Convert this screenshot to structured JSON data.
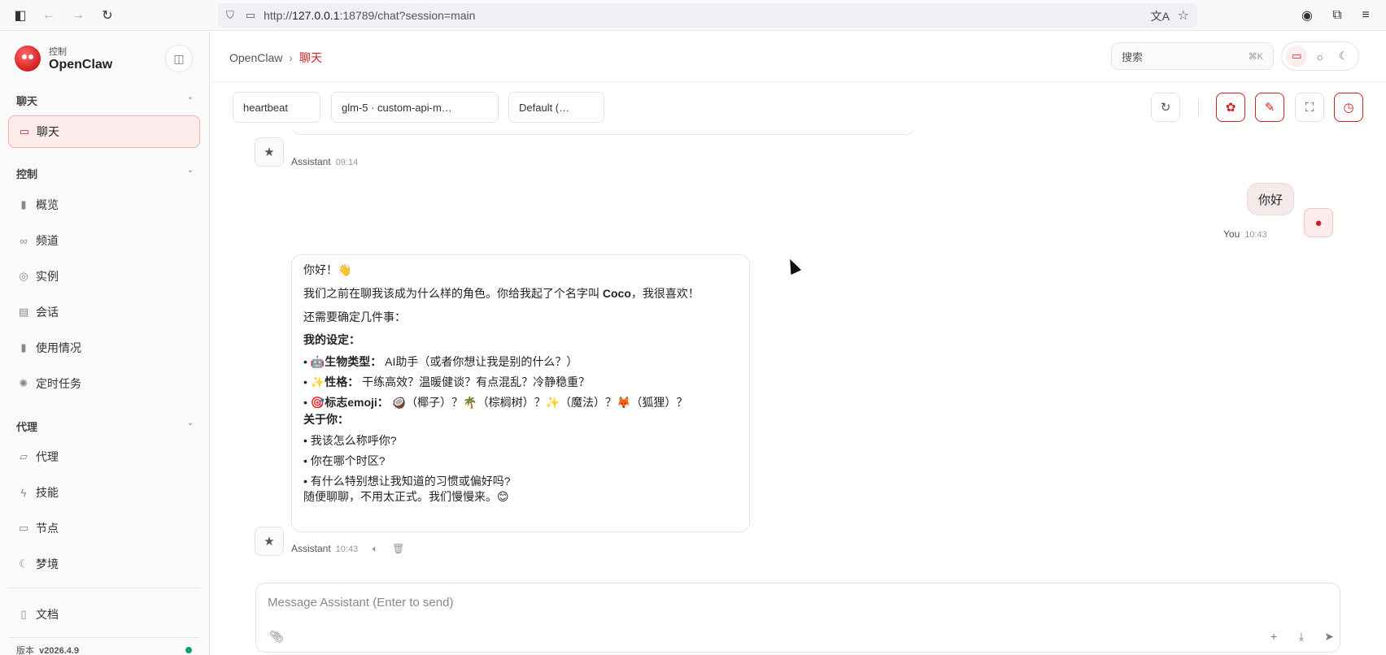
{
  "browser": {
    "url_prefix": "http://",
    "url_host": "127.0.0.1",
    "url_rest": ":18789/chat?session=main"
  },
  "sidebar": {
    "brand_sub": "控制",
    "brand_name": "OpenClaw",
    "sections": {
      "chat": "聊天",
      "control": "控制",
      "agent": "代理"
    },
    "items": {
      "chat": "聊天",
      "overview": "概览",
      "channels": "频道",
      "instances": "实例",
      "sessions": "会话",
      "usage": "使用情况",
      "cron": "定时任务",
      "agents": "代理",
      "skills": "技能",
      "nodes": "节点",
      "dreams": "梦境",
      "docs": "文档"
    },
    "version_label": "版本",
    "version_value": "v2026.4.9"
  },
  "header": {
    "breadcrumb_root": "OpenClaw",
    "breadcrumb_sep": "›",
    "breadcrumb_current": "聊天",
    "search_placeholder": "搜索",
    "search_kbd": "⌘K"
  },
  "toolbar": {
    "session": "heartbeat",
    "model": "glm-5 · custom-api-m…",
    "thinking": "Default (…"
  },
  "messages": {
    "prev_assistant_name": "Assistant",
    "prev_assistant_time": "09:14",
    "user_text": "你好",
    "user_name": "You",
    "user_time": "10:43",
    "assistant_name": "Assistant",
    "assistant_time": "10:43",
    "reply": {
      "greeting": "你好！👋",
      "intro_a": "我们之前在聊我该成为什么样的角色。你给我起了个名字叫 ",
      "intro_name": "Coco",
      "intro_b": "，我很喜欢！",
      "need_confirm": "还需要确定几件事：",
      "my_settings": "我的设定：",
      "bullet1_emoji": "🤖",
      "bullet1_label": "生物类型：",
      "bullet1_text": " AI助手（或者你想让我是别的什么？）",
      "bullet2_emoji": "✨",
      "bullet2_label": "性格：",
      "bullet2_text": " 干练高效？温暖健谈？有点混乱？冷静稳重？",
      "bullet3_emoji": "🎯",
      "bullet3_label": "标志emoji：",
      "bullet3_text": " 🥥（椰子）？🌴（棕榈树）？✨（魔法）？🦊（狐狸）？",
      "about_you": "关于你：",
      "q1": "我该怎么称呼你?",
      "q2": "你在哪个时区?",
      "q3": "有什么特别想让我知道的习惯或偏好吗?",
      "closing": "随便聊聊，不用太正式。我们慢慢来。😊"
    }
  },
  "composer": {
    "placeholder": "Message Assistant (Enter to send)"
  }
}
